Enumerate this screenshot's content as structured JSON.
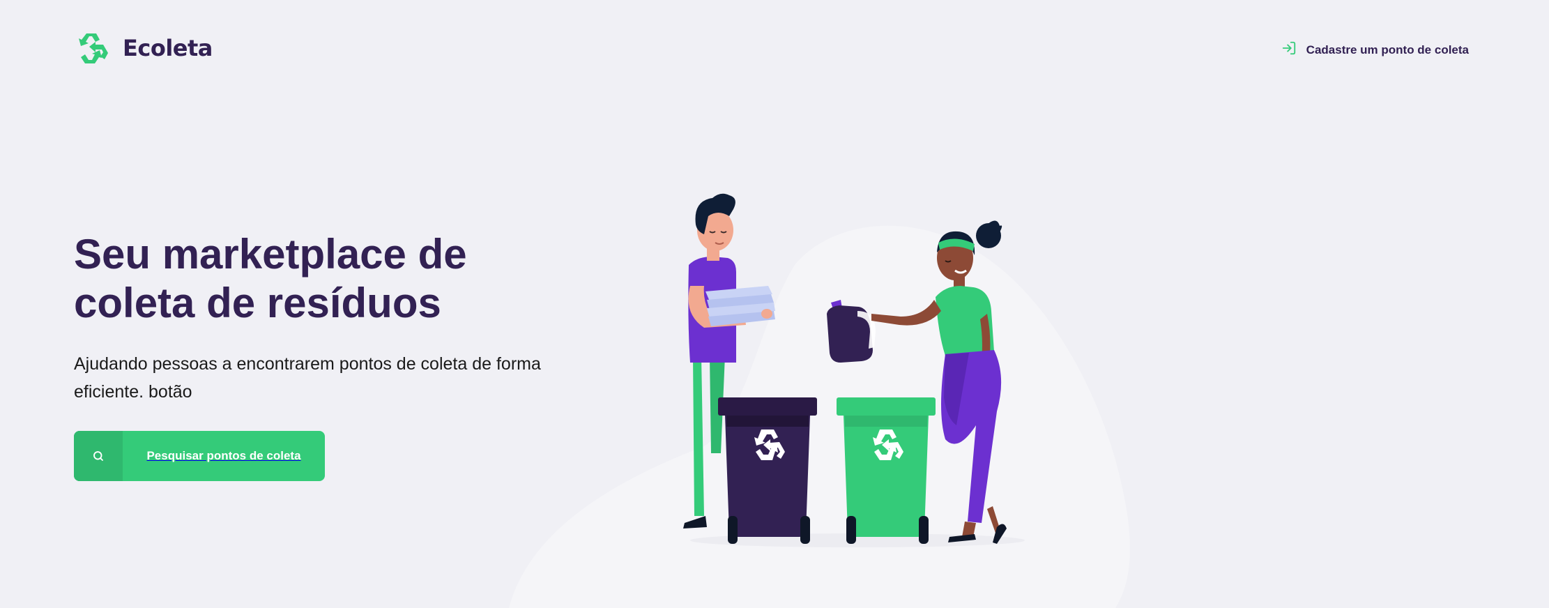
{
  "header": {
    "logo_text": "Ecoleta",
    "logo_icon": "recycle-icon",
    "register_link_label": "Cadastre um ponto de coleta",
    "register_link_icon": "log-in-icon"
  },
  "hero": {
    "title": "Seu marketplace de coleta de resíduos",
    "description": "Ajudando pessoas a encontrarem pontos de coleta de forma eficiente. botão"
  },
  "search_button": {
    "label": "Pesquisar pontos de coleta",
    "icon": "search-icon"
  },
  "illustration": {
    "name": "people-recycling-illustration"
  },
  "colors": {
    "background": "#f0f0f5",
    "primary_green": "#34cb79",
    "dark_green": "#2fb86e",
    "title_purple": "#322153",
    "accent_purple": "#6c30d0"
  }
}
